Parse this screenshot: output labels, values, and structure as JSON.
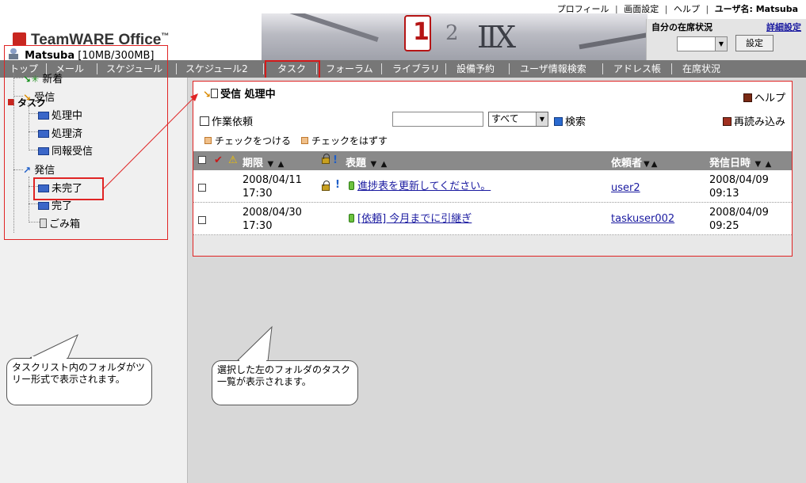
{
  "top_links": [
    "プロフィール",
    "画面設定",
    "ヘルプ",
    "ユーザ名: Matsuba"
  ],
  "logo": "TeamWARE Office",
  "logo_mark": "™",
  "banner_numbers": {
    "one": "1",
    "two": "2",
    "roman": "IIX"
  },
  "presence": {
    "label": "自分の在席状況",
    "detail_link": "詳細設定",
    "select_value": "",
    "button": "設定"
  },
  "nav": [
    "トップ",
    "メール",
    "スケジュール",
    "スケジュール2",
    "タスク",
    "フォーラム",
    "ライブラリ",
    "設備予約",
    "ユーザ情報検索",
    "アドレス帳",
    "在席状況"
  ],
  "nav_selected": "タスク",
  "sidebar": {
    "heading": "タスク",
    "user": "Matsuba",
    "quota": "[10MB/300MB]",
    "tree": {
      "new": "新着",
      "received": "受信",
      "in_progress": "処理中",
      "done": "処理済",
      "cc": "同報受信",
      "sent": "発信",
      "incomplete": "未完了",
      "complete": "完了",
      "trash": "ごみ箱"
    }
  },
  "main": {
    "title": "受信 処理中",
    "help": "ヘルプ",
    "work_request": "作業依頼",
    "search_value": "",
    "filter": "すべて",
    "search_button": "検索",
    "reload": "再読み込み",
    "check_on": "チェックをつける",
    "check_off": "チェックをはずす"
  },
  "table": {
    "columns": {
      "deadline": "期限",
      "subject": "表題",
      "requester": "依頼者",
      "sent": "発信日時"
    },
    "rows": [
      {
        "deadline_date": "2008/04/11",
        "deadline_time": "17:30",
        "subject": "進捗表を更新してください。",
        "requester": "user2",
        "sent_date": "2008/04/09",
        "sent_time": "09:13"
      },
      {
        "deadline_date": "2008/04/30",
        "deadline_time": "17:30",
        "subject": "[依頼] 今月までに引継ぎ",
        "requester": "taskuser002",
        "sent_date": "2008/04/09",
        "sent_time": "09:25"
      }
    ]
  },
  "callouts": {
    "left": "タスクリスト内のフォルダがツリー形式で表示されます。",
    "right": "選択した左のフォルダのタスク一覧が表示されます。"
  },
  "colors": {
    "accent_red": "#d21a1a",
    "nav_bg": "#777777",
    "link": "#1a1aa0"
  }
}
